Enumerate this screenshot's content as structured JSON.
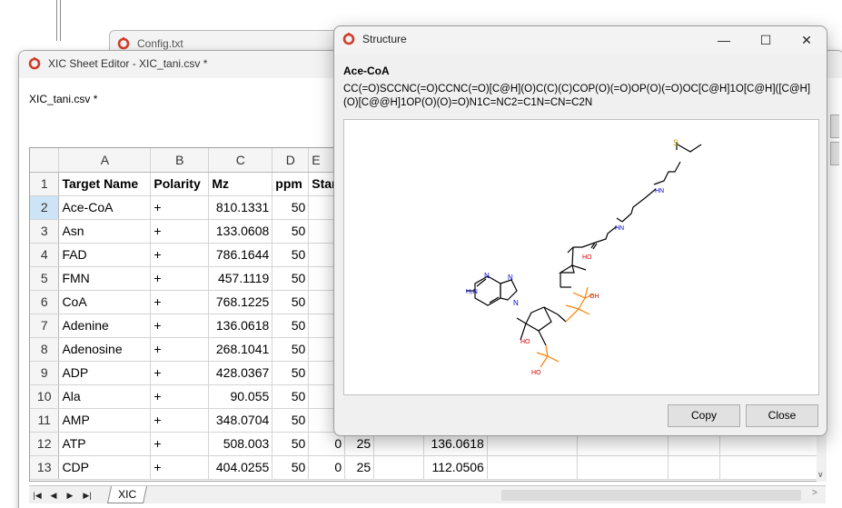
{
  "config_window": {
    "title": "Config.txt"
  },
  "editor": {
    "title": "XIC Sheet Editor - XIC_tani.csv *",
    "file_label": "XIC_tani.csv *",
    "columns": [
      "A",
      "B",
      "C",
      "D",
      "E"
    ],
    "header": {
      "row": "1",
      "cells": [
        "Target Name",
        "Polarity",
        "Mz",
        "ppm",
        "Star"
      ]
    },
    "rows": [
      {
        "n": "2",
        "name": "Ace-CoA",
        "pol": "+",
        "mz": "810.1331",
        "ppm": "50",
        "e": "",
        "f": "",
        "g": ""
      },
      {
        "n": "3",
        "name": "Asn",
        "pol": "+",
        "mz": "133.0608",
        "ppm": "50",
        "e": "",
        "f": "",
        "g": ""
      },
      {
        "n": "4",
        "name": "FAD",
        "pol": "+",
        "mz": "786.1644",
        "ppm": "50",
        "e": "",
        "f": "",
        "g": ""
      },
      {
        "n": "5",
        "name": "FMN",
        "pol": "+",
        "mz": "457.1119",
        "ppm": "50",
        "e": "",
        "f": "",
        "g": ""
      },
      {
        "n": "6",
        "name": "CoA",
        "pol": "+",
        "mz": "768.1225",
        "ppm": "50",
        "e": "",
        "f": "",
        "g": ""
      },
      {
        "n": "7",
        "name": "Adenine",
        "pol": "+",
        "mz": "136.0618",
        "ppm": "50",
        "e": "",
        "f": "",
        "g": ""
      },
      {
        "n": "8",
        "name": "Adenosine",
        "pol": "+",
        "mz": "268.1041",
        "ppm": "50",
        "e": "",
        "f": "",
        "g": ""
      },
      {
        "n": "9",
        "name": "ADP",
        "pol": "+",
        "mz": "428.0367",
        "ppm": "50",
        "e": "",
        "f": "",
        "g": ""
      },
      {
        "n": "10",
        "name": "Ala",
        "pol": "+",
        "mz": "90.055",
        "ppm": "50",
        "e": "",
        "f": "",
        "g": ""
      },
      {
        "n": "11",
        "name": "AMP",
        "pol": "+",
        "mz": "348.0704",
        "ppm": "50",
        "e": "",
        "f": "",
        "g": ""
      },
      {
        "n": "12",
        "name": "ATP",
        "pol": "+",
        "mz": "508.003",
        "ppm": "50",
        "e": "0",
        "f": "25",
        "g": "136.0618"
      },
      {
        "n": "13",
        "name": "CDP",
        "pol": "+",
        "mz": "404.0255",
        "ppm": "50",
        "e": "0",
        "f": "25",
        "g": "112.0506"
      }
    ],
    "sheet_tab": "XIC",
    "nav_buttons": [
      "|◀",
      "◀",
      "▶",
      "▶|"
    ]
  },
  "structure": {
    "title": "Structure",
    "name": "Ace-CoA",
    "smiles": "CC(=O)SCCNC(=O)CCNC(=O)[C@H](O)C(C)(C)COP(O)(=O)OP(O)(=O)OC[C@H]1O[C@H]([C@H](O)[C@@H]1OP(O)(O)=O)N1C=NC2=C1N=CN=C2N",
    "atom_labels": {
      "s": "S",
      "o": "O",
      "hn": "HN",
      "nh2": "H₂N",
      "n": "N",
      "ho": "HO",
      "oh": "OH"
    },
    "copy_label": "Copy",
    "close_label": "Close",
    "caption_minimize": "—",
    "caption_maximize": "☐",
    "caption_close": "✕"
  },
  "colors": {
    "selected_row_header": "#cde4f7",
    "oxygen": "#e00000",
    "nitrogen": "#0000e0",
    "sulfur": "#c8a000",
    "phosphorus": "#ff8000"
  }
}
